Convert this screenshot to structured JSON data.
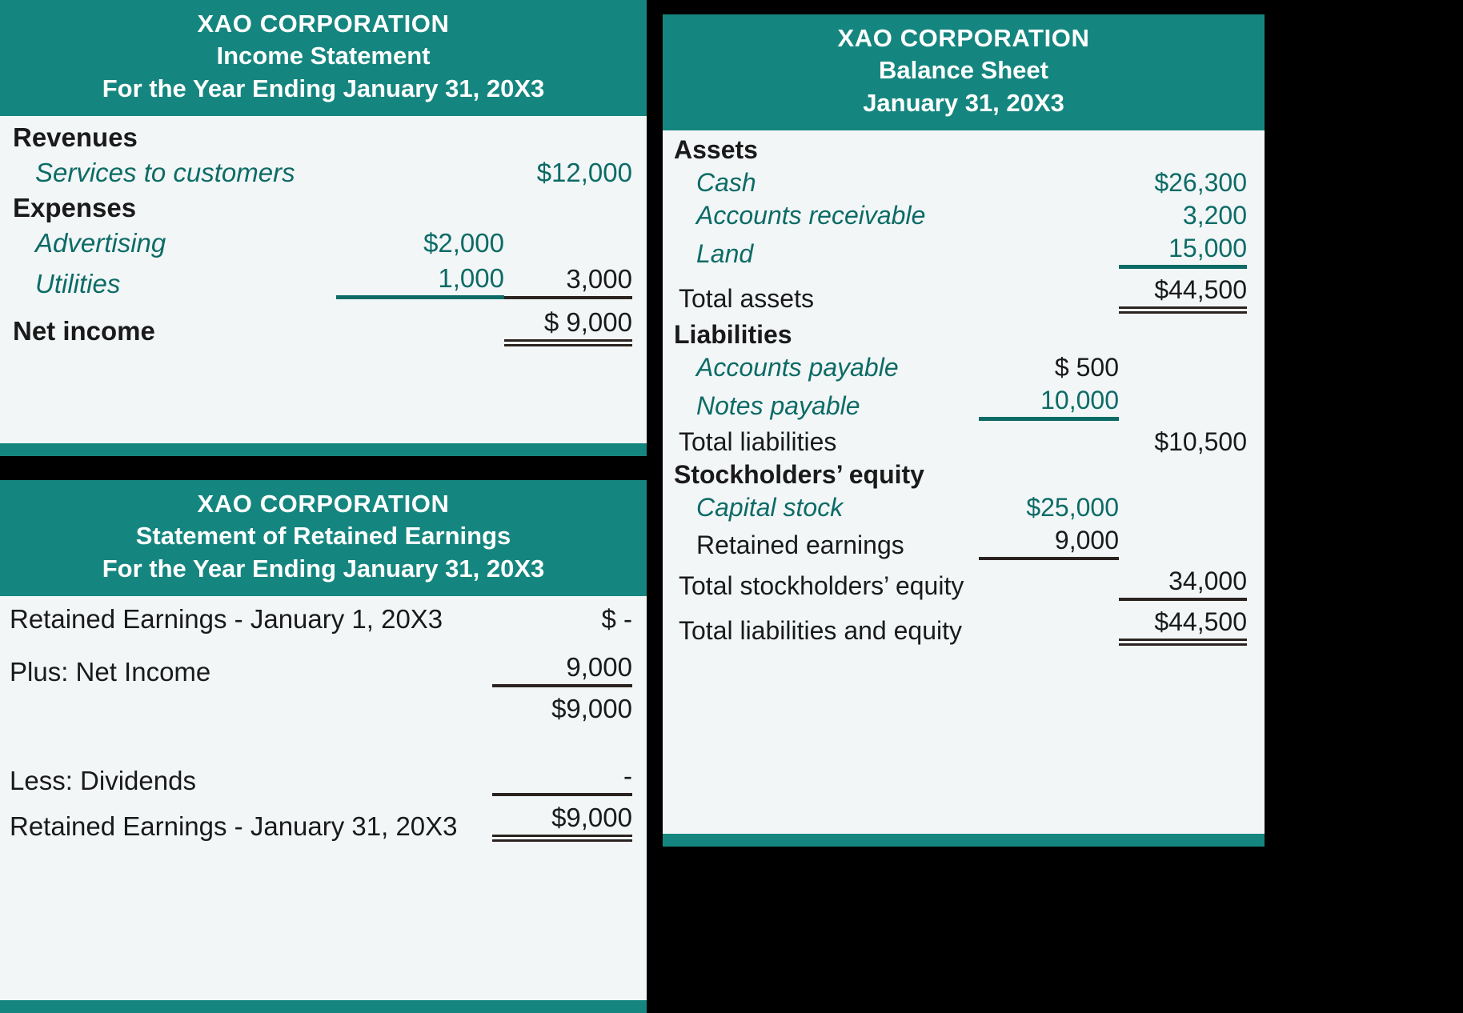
{
  "income_statement": {
    "header": {
      "company": "XAO CORPORATION",
      "statement": "Income Statement",
      "period": "For the Year Ending January 31, 20X3"
    },
    "rows": [
      {
        "label": "Revenues",
        "mid": "",
        "right": ""
      },
      {
        "label": "Services to customers",
        "mid": "",
        "right": "$12,000"
      },
      {
        "label": "Expenses",
        "mid": "",
        "right": ""
      },
      {
        "label": "Advertising",
        "mid": "$2,000",
        "right": ""
      },
      {
        "label": "Utilities",
        "mid": "1,000",
        "right": "3,000"
      },
      {
        "label": "Net income",
        "mid": "",
        "right": "$  9,000"
      }
    ]
  },
  "retained_earnings": {
    "header": {
      "company": "XAO CORPORATION",
      "statement": "Statement of Retained Earnings",
      "period": "For the Year Ending January 31, 20X3"
    },
    "rows": [
      {
        "label": "Retained Earnings - January 1, 20X3",
        "amount": "$            -"
      },
      {
        "label": "Plus: Net Income",
        "amount": "9,000"
      },
      {
        "label": "",
        "amount": "$9,000"
      },
      {
        "label": "Less: Dividends",
        "amount": "-"
      },
      {
        "label": "Retained Earnings - January 31, 20X3",
        "amount": "$9,000"
      }
    ]
  },
  "balance_sheet": {
    "header": {
      "company": "XAO CORPORATION",
      "statement": "Balance Sheet",
      "period": "January 31, 20X3"
    },
    "rows": [
      {
        "label": "Assets",
        "mid": "",
        "right": ""
      },
      {
        "label": "Cash",
        "mid": "",
        "right": "$26,300"
      },
      {
        "label": "Accounts receivable",
        "mid": "",
        "right": "3,200"
      },
      {
        "label": "Land",
        "mid": "",
        "right": "15,000"
      },
      {
        "label": "Total assets",
        "mid": "",
        "right": "$44,500"
      },
      {
        "label": "Liabilities",
        "mid": "",
        "right": ""
      },
      {
        "label": "Accounts payable",
        "mid": "$     500",
        "right": ""
      },
      {
        "label": "Notes payable",
        "mid": "10,000",
        "right": ""
      },
      {
        "label": "Total liabilities",
        "mid": "",
        "right": "$10,500"
      },
      {
        "label": "Stockholders’ equity",
        "mid": "",
        "right": ""
      },
      {
        "label": "Capital stock",
        "mid": "$25,000",
        "right": ""
      },
      {
        "label": "Retained earnings",
        "mid": "9,000",
        "right": ""
      },
      {
        "label": "Total stockholders’ equity",
        "mid": "",
        "right": "34,000"
      },
      {
        "label": "Total liabilities and equity",
        "mid": "",
        "right": "$44,500"
      }
    ]
  },
  "colors": {
    "header_teal": "#15867f",
    "item_teal": "#0d6b66",
    "text_dark": "#1a1a1a",
    "card_bg": "#f2f6f7",
    "page_bg": "#000000"
  }
}
